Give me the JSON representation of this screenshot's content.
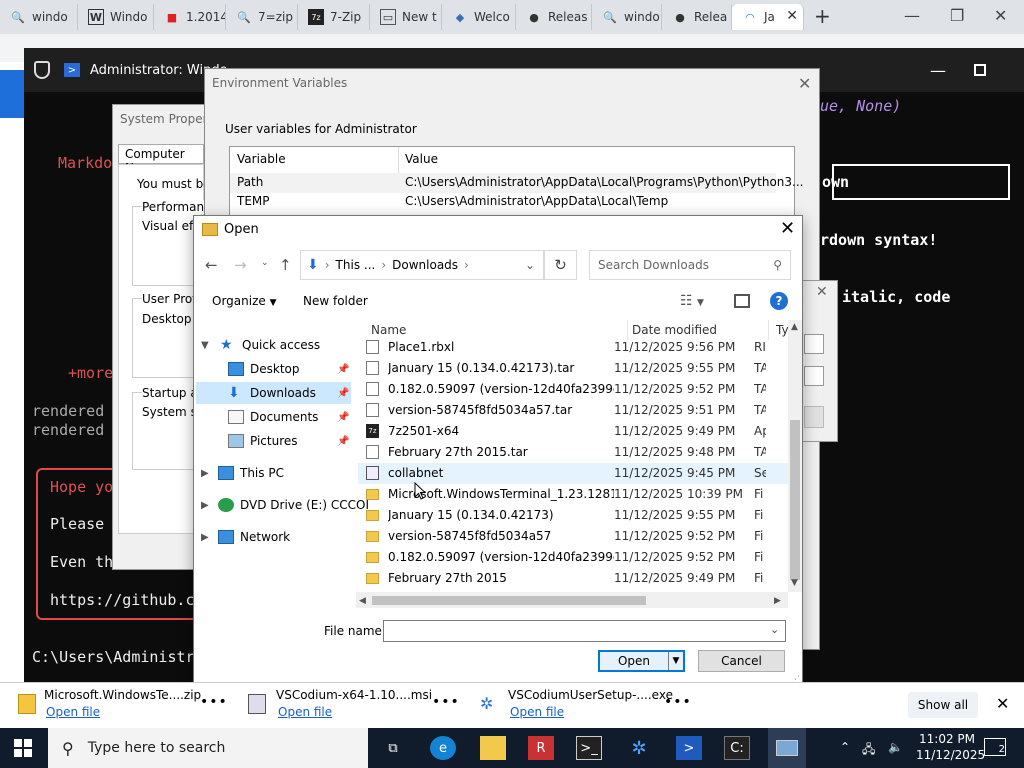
{
  "browser": {
    "tabs": [
      {
        "label": "windo",
        "icon": "search-icon"
      },
      {
        "label": "Windo",
        "icon": "w-site-icon"
      },
      {
        "label": "1.2014",
        "icon": "red-site-icon"
      },
      {
        "label": "7=zip",
        "icon": "search-icon"
      },
      {
        "label": "7-Zip",
        "icon": "7zip-icon"
      },
      {
        "label": "New t",
        "icon": "new-tab-icon"
      },
      {
        "label": "Welco",
        "icon": "python-icon"
      },
      {
        "label": "Releas",
        "icon": "github-icon"
      },
      {
        "label": "windo",
        "icon": "search-icon"
      },
      {
        "label": "Relea",
        "icon": "github-icon"
      },
      {
        "label": "Ja",
        "icon": "app-icon"
      }
    ],
    "new_tab": "+"
  },
  "terminal": {
    "title": "Administrator: Windo",
    "lines": {
      "l1": "ue, None)",
      "l2": "Markdo",
      "l3": "own",
      "l4": "rdown syntax!",
      "l5": "italic, code",
      "l6": "+more",
      "l7": "rendered",
      "l8": "rendered",
      "l9": "Hope yo",
      "l10": "Please",
      "l11": "Even th",
      "l12": "https://github.c",
      "prompt": "C:\\Users\\Administr"
    }
  },
  "system_properties": {
    "title": "System Properti",
    "tab": "Computer Name",
    "text1": "You must be lo",
    "perf": "Performance",
    "visual": "Visual effe",
    "user_prof": "User Prof",
    "desktop": "Desktop",
    "startup": "Startup ar",
    "system_st": "System st"
  },
  "env_vars": {
    "title": "Environment Variables",
    "group": "User variables for Administrator",
    "columns": [
      "Variable",
      "Value"
    ],
    "rows": [
      {
        "var": "Path",
        "value": "C:\\Users\\Administrator\\AppData\\Local\\Programs\\Python\\Python3..."
      },
      {
        "var": "TEMP",
        "value": "C:\\Users\\Administrator\\AppData\\Local\\Temp"
      }
    ]
  },
  "open_dialog": {
    "title": "Open",
    "address": {
      "part1": "This ...",
      "part2": "Downloads"
    },
    "search_placeholder": "Search Downloads",
    "organize": "Organize",
    "new_folder": "New folder",
    "nav": {
      "quick_access": "Quick access",
      "desktop": "Desktop",
      "downloads": "Downloads",
      "documents": "Documents",
      "pictures": "Pictures",
      "this_pc": "This PC",
      "dvd": "DVD Drive (E:) CCCOI",
      "network": "Network"
    },
    "columns": {
      "name": "Name",
      "date": "Date modified",
      "type": "Ty"
    },
    "files": [
      {
        "name": "Place1.rbxl",
        "date": "11/12/2025 9:56 PM",
        "type": "RI",
        "kind": "file"
      },
      {
        "name": "January 15 (0.134.0.42173).tar",
        "date": "11/12/2025 9:55 PM",
        "type": "TA",
        "kind": "file"
      },
      {
        "name": "0.182.0.59097 (version-12d40fa2399e46ca...",
        "date": "11/12/2025 9:52 PM",
        "type": "TA",
        "kind": "file"
      },
      {
        "name": "version-58745f8fd5034a57.tar",
        "date": "11/12/2025 9:51 PM",
        "type": "TA",
        "kind": "file"
      },
      {
        "name": "7z2501-x64",
        "date": "11/12/2025 9:49 PM",
        "type": "Ap",
        "kind": "zip7"
      },
      {
        "name": "February 27th 2015.tar",
        "date": "11/12/2025 9:48 PM",
        "type": "TA",
        "kind": "file"
      },
      {
        "name": "collabnet",
        "date": "11/12/2025 9:45 PM",
        "type": "Se",
        "kind": "app"
      },
      {
        "name": "Microsoft.WindowsTerminal_1.23.12811.0...",
        "date": "11/12/2025 10:39 PM",
        "type": "Fi",
        "kind": "folder"
      },
      {
        "name": "January 15 (0.134.0.42173)",
        "date": "11/12/2025 9:55 PM",
        "type": "Fi",
        "kind": "folder"
      },
      {
        "name": "version-58745f8fd5034a57",
        "date": "11/12/2025 9:52 PM",
        "type": "Fi",
        "kind": "folder"
      },
      {
        "name": "0.182.0.59097 (version-12d40fa2399e46ca)",
        "date": "11/12/2025 9:52 PM",
        "type": "Fi",
        "kind": "folder"
      },
      {
        "name": "February 27th 2015",
        "date": "11/12/2025 9:49 PM",
        "type": "Fi",
        "kind": "folder"
      }
    ],
    "file_name_label": "File name:",
    "file_name_value": "",
    "open_button": "Open",
    "cancel_button": "Cancel"
  },
  "downloads_bar": {
    "items": [
      {
        "name": "Microsoft.WindowsTe....zip",
        "link": "Open file"
      },
      {
        "name": "VSCodium-x64-1.10....msi",
        "link": "Open file"
      },
      {
        "name": "VSCodiumUserSetup-....exe",
        "link": "Open file"
      }
    ],
    "show_all": "Show all"
  },
  "taskbar": {
    "search_placeholder": "Type here to search",
    "time": "11:02 PM",
    "date": "11/12/2025",
    "notifications": "2"
  }
}
